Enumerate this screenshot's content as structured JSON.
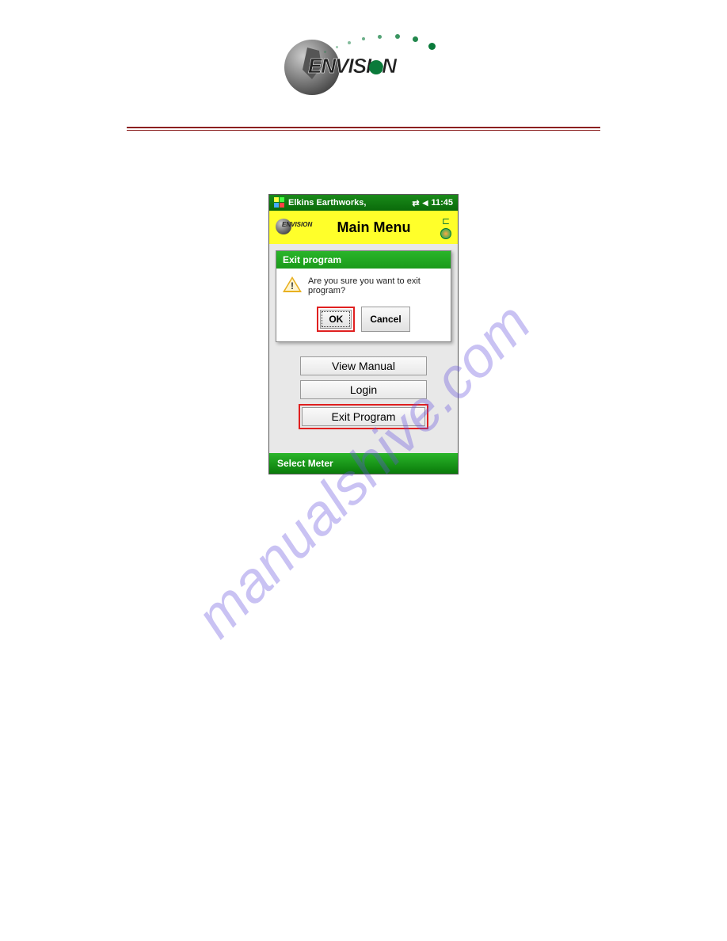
{
  "logo": {
    "text_parts": [
      "ENVISI",
      "N"
    ]
  },
  "device": {
    "statusbar": {
      "app": "Elkins Earthworks,",
      "time": "11:45"
    },
    "titlebar": {
      "title": "Main Menu"
    },
    "dialog": {
      "header": "Exit program",
      "message": "Are you sure you want to exit program?",
      "ok": "OK",
      "cancel": "Cancel"
    },
    "menu": {
      "view_manual": "View Manual",
      "login": "Login",
      "exit_program": "Exit Program"
    },
    "bottombar": "Select Meter"
  },
  "watermark": "manualshive.com"
}
